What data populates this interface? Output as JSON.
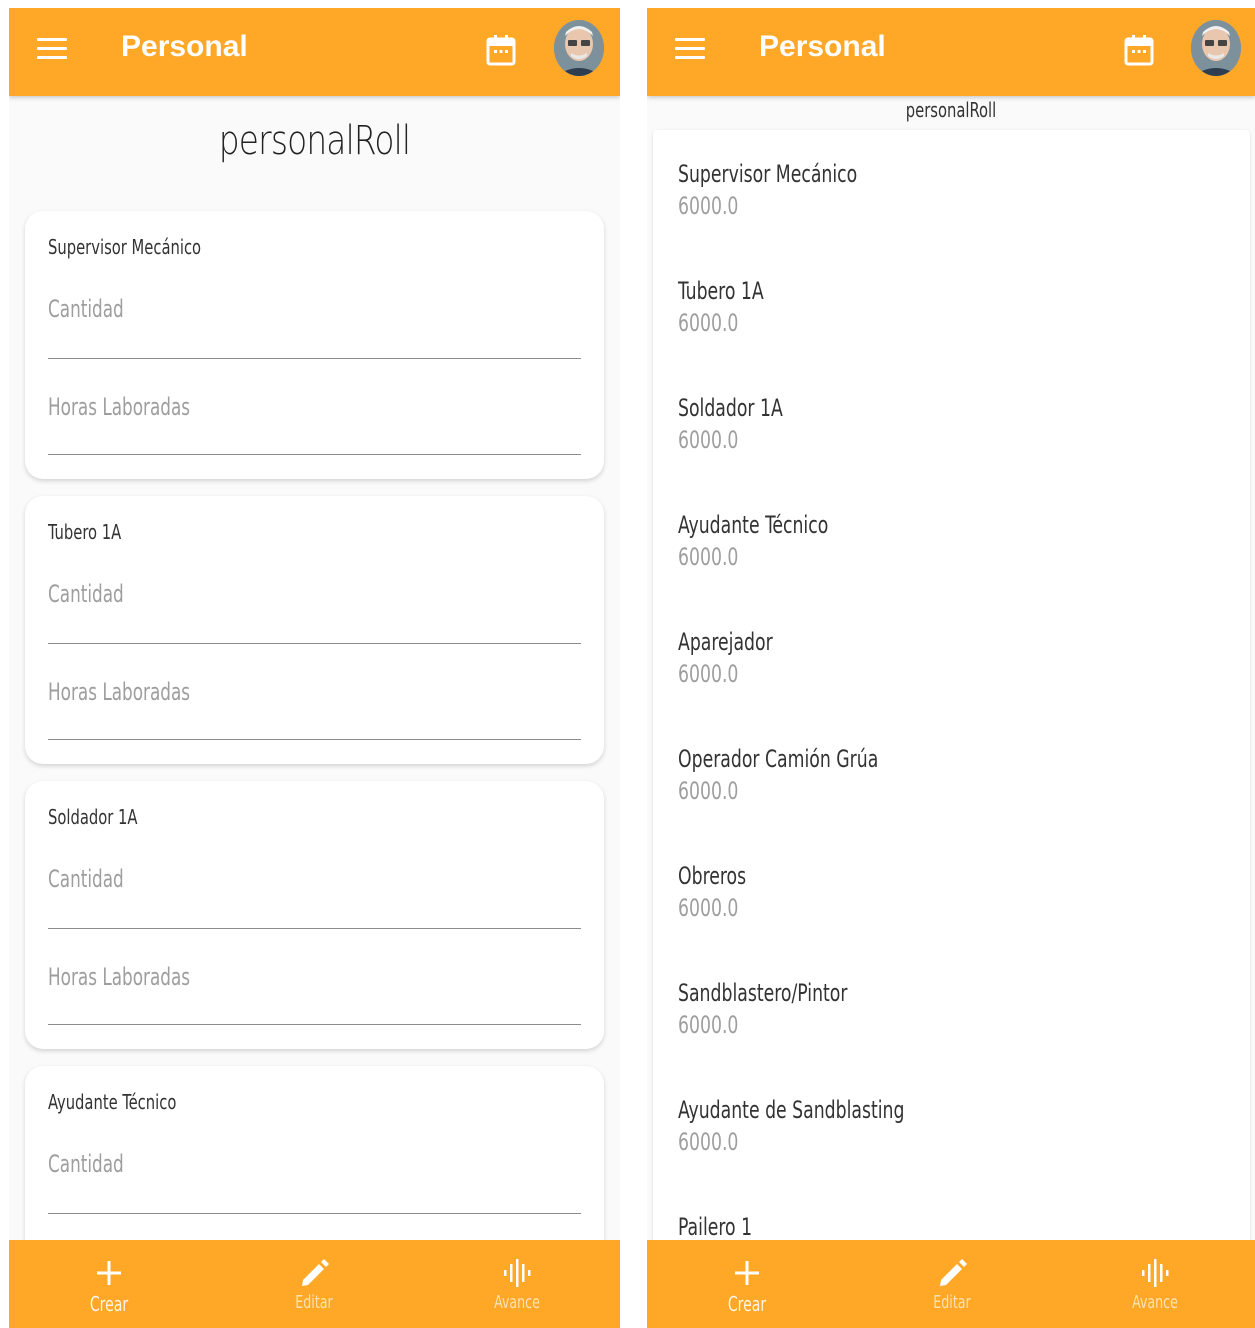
{
  "app": {
    "title": "Personal",
    "accent_color": "#ffa726",
    "icons": {
      "menu": "menu-icon",
      "calendar": "calendar-icon",
      "avatar": "user-avatar"
    }
  },
  "left_screen": {
    "heading": "personalRoll",
    "cards": [
      {
        "title": "Supervisor Mecánico",
        "fields": [
          {
            "placeholder": "Cantidad"
          },
          {
            "placeholder": "Horas Laboradas"
          }
        ]
      },
      {
        "title": "Tubero 1A",
        "fields": [
          {
            "placeholder": "Cantidad"
          },
          {
            "placeholder": "Horas Laboradas"
          }
        ]
      },
      {
        "title": "Soldador 1A",
        "fields": [
          {
            "placeholder": "Cantidad"
          },
          {
            "placeholder": "Horas Laboradas"
          }
        ]
      },
      {
        "title": "Ayudante Técnico",
        "fields": [
          {
            "placeholder": "Cantidad"
          }
        ]
      }
    ]
  },
  "right_screen": {
    "heading": "personalRoll",
    "items": [
      {
        "title": "Supervisor Mecánico",
        "value": "6000.0"
      },
      {
        "title": "Tubero 1A",
        "value": "6000.0"
      },
      {
        "title": "Soldador 1A",
        "value": "6000.0"
      },
      {
        "title": "Ayudante Técnico",
        "value": "6000.0"
      },
      {
        "title": "Aparejador",
        "value": "6000.0"
      },
      {
        "title": "Operador Camión Grúa",
        "value": "6000.0"
      },
      {
        "title": "Obreros",
        "value": "6000.0"
      },
      {
        "title": "Sandblastero/Pintor",
        "value": "6000.0"
      },
      {
        "title": "Ayudante de Sandblasting",
        "value": "6000.0"
      },
      {
        "title": "Pailero 1",
        "value": ""
      }
    ]
  },
  "bottom_nav": {
    "items": [
      {
        "label": "Crear",
        "icon": "plus-icon"
      },
      {
        "label": "Editar",
        "icon": "pencil-icon"
      },
      {
        "label": "Avance",
        "icon": "waveform-icon"
      }
    ]
  }
}
